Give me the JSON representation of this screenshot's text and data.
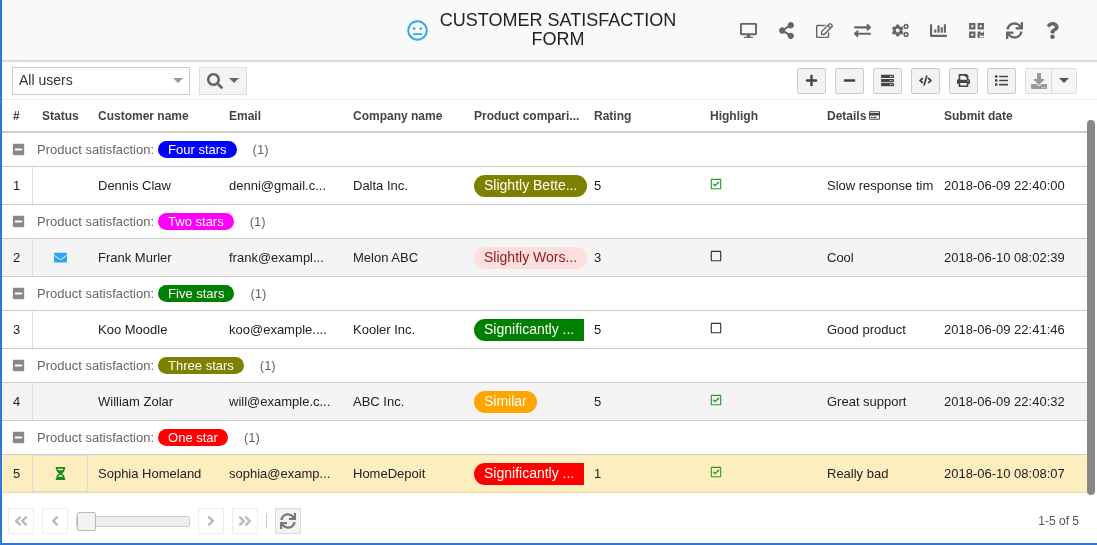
{
  "header": {
    "title": "CUSTOMER SATISFACTION FORM"
  },
  "toolbar": {
    "user_filter": "All users"
  },
  "columns": [
    "#",
    "Status",
    "Customer name",
    "Email",
    "Company name",
    "Product compari...",
    "Rating",
    "Highligh",
    "Details",
    "Submit date"
  ],
  "groups": [
    {
      "label": "Product satisfaction:",
      "tag": "Four stars",
      "color": "#0000ff",
      "count": "(1)",
      "expanded": true,
      "rows": [
        {
          "num": "1",
          "name": "Dennis Claw",
          "email": "denni@gmail.c...",
          "company": "Dalta Inc.",
          "comparison": {
            "label": "Slightly Bette...",
            "kind": "pill",
            "color": "#808000"
          },
          "rating": "5",
          "highlight": true,
          "details": "Slow response tim",
          "date": "2018-06-09 22:40:00",
          "selected": false
        }
      ]
    },
    {
      "label": "Product satisfaction:",
      "tag": "Two stars",
      "color": "#ff00ff",
      "count": "(1)",
      "expanded": true,
      "rows": [
        {
          "num": "2",
          "status": {
            "kind": "mail"
          },
          "name": "Frank Murler",
          "email": "frank@exampl...",
          "company": "Melon ABC",
          "comparison": {
            "label": "Slightly Wors...",
            "kind": "soft",
            "color": "#ffdede"
          },
          "rating": "3",
          "highlight": false,
          "details": "Cool",
          "date": "2018-06-10 08:02:39",
          "selected": false
        }
      ]
    },
    {
      "label": "Product satisfaction:",
      "tag": "Five stars",
      "color": "#008000",
      "count": "(1)",
      "expanded": true,
      "rows": [
        {
          "num": "3",
          "name": "Koo Moodle",
          "email": "koo@example....",
          "company": "Kooler Inc.",
          "comparison": {
            "label": "Significantly ...",
            "kind": "flag",
            "color": "#008000"
          },
          "rating": "5",
          "highlight": false,
          "details": "Good product",
          "date": "2018-06-09 22:41:46",
          "selected": false
        }
      ]
    },
    {
      "label": "Product satisfaction:",
      "tag": "Three stars",
      "color": "#808000",
      "count": "(1)",
      "expanded": true,
      "rows": [
        {
          "num": "4",
          "name": "William Zolar",
          "email": "will@example.c...",
          "company": "ABC Inc.",
          "comparison": {
            "label": "Similar",
            "kind": "pill",
            "color": "#ffa500"
          },
          "rating": "5",
          "highlight": true,
          "details": "Great support",
          "date": "2018-06-09 22:40:32",
          "selected": false
        }
      ]
    },
    {
      "label": "Product satisfaction:",
      "tag": "One star",
      "color": "#ff0000",
      "count": "(1)",
      "expanded": true,
      "rows": [
        {
          "num": "5",
          "status": {
            "kind": "pending"
          },
          "name": "Sophia Homeland",
          "email": "sophia@examp...",
          "company": "HomeDepoit",
          "comparison": {
            "label": "Significantly ...",
            "kind": "flag",
            "color": "#ff0000"
          },
          "rating": "1",
          "highlight": true,
          "details": "Really bad",
          "date": "2018-06-10 08:08:07",
          "selected": true
        }
      ]
    }
  ],
  "pager": {
    "level": 0,
    "summary": "1-5 of 5"
  }
}
